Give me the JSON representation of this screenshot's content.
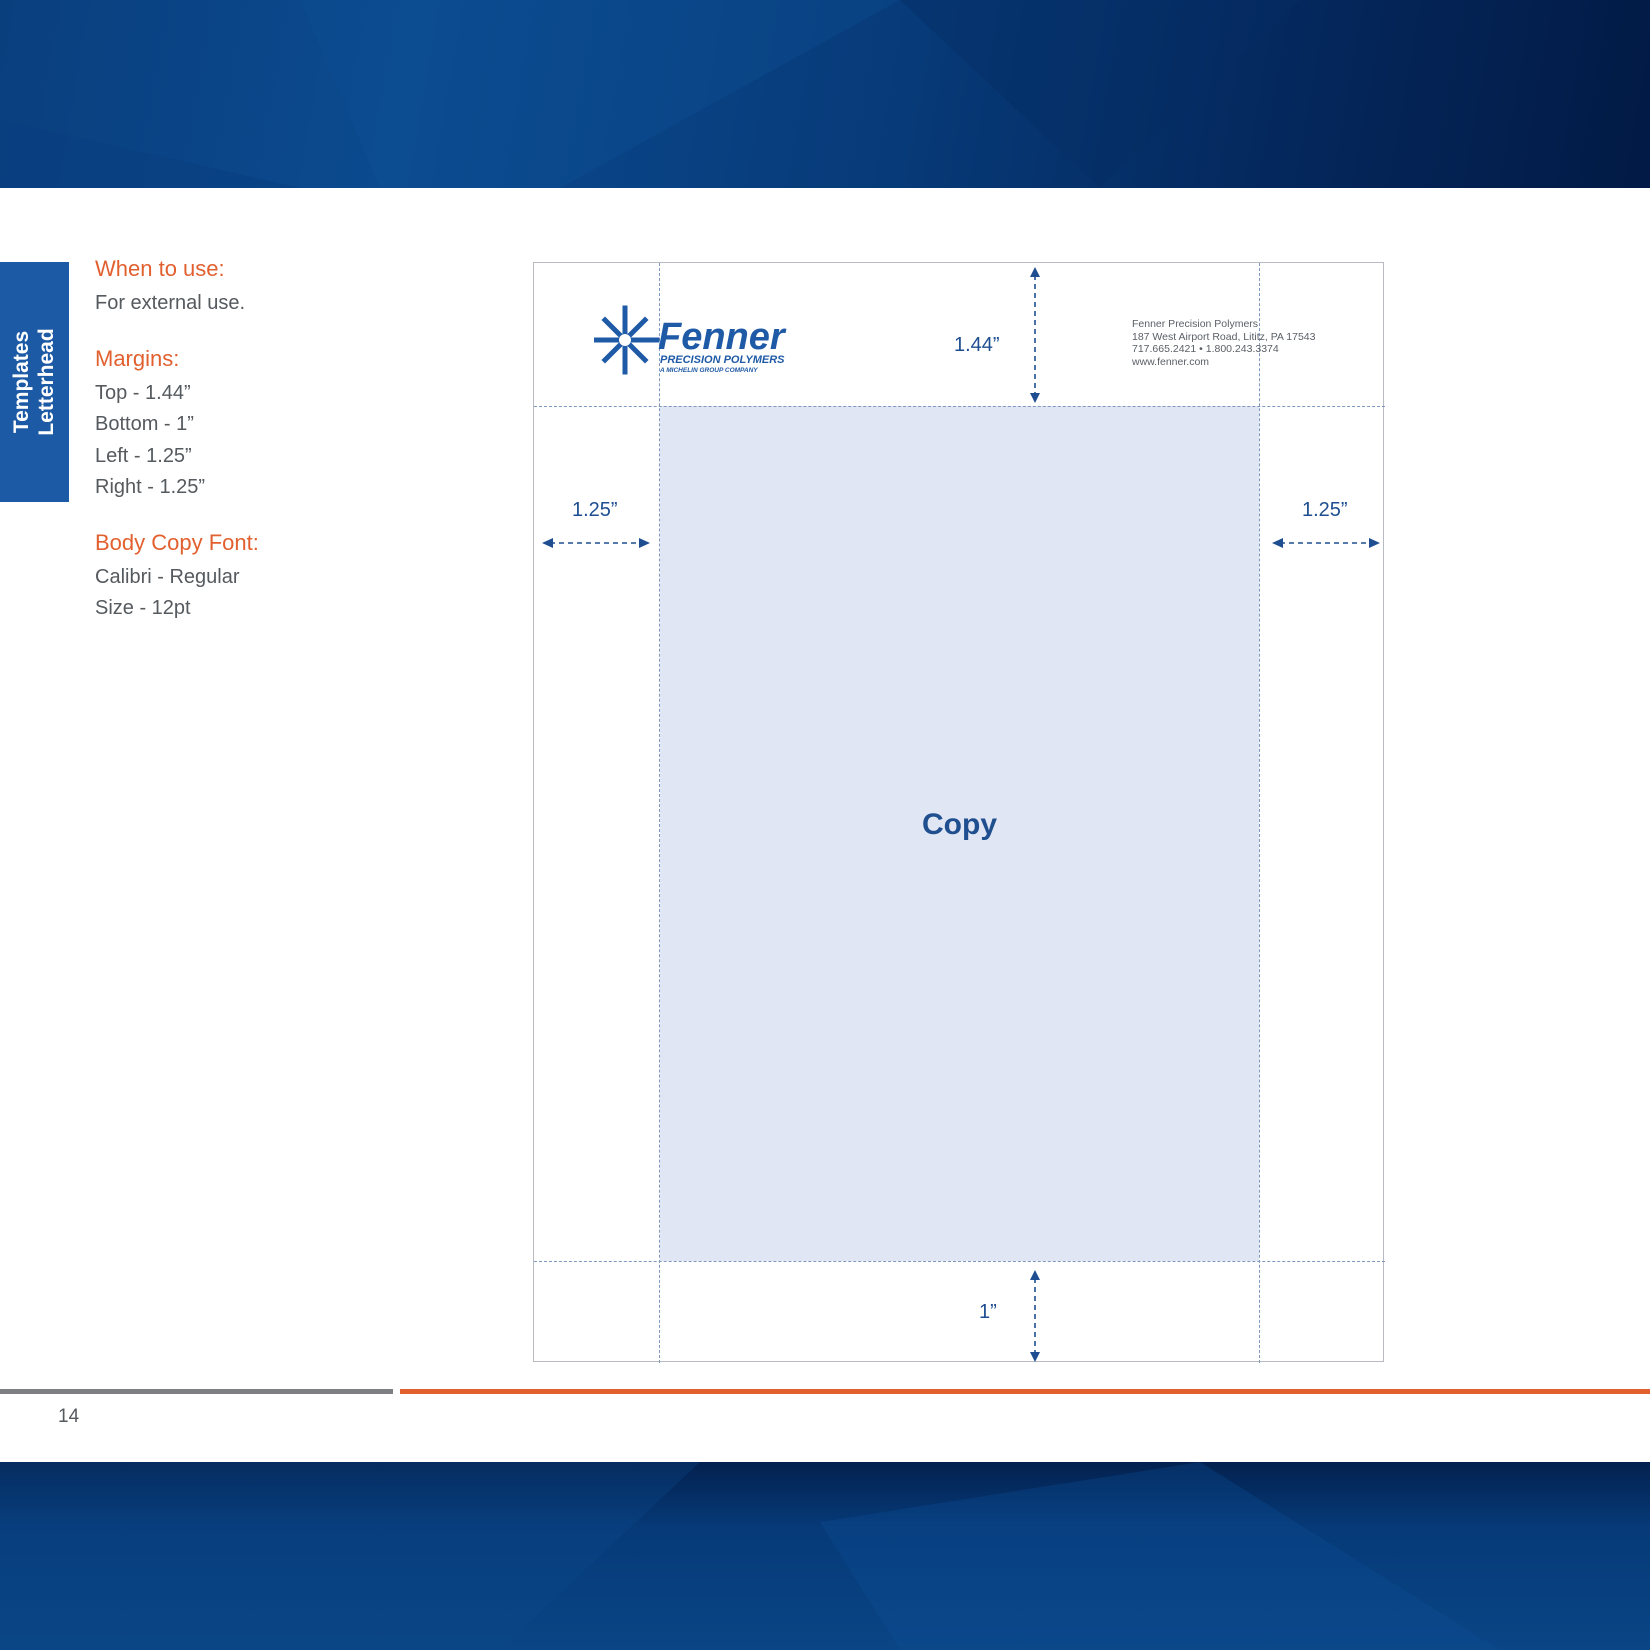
{
  "sidebar_tab": {
    "line1": "Templates",
    "line2": "Letterhead"
  },
  "sections": [
    {
      "heading": "When to use:",
      "lines": [
        "For external use."
      ]
    },
    {
      "heading": "Margins:",
      "lines": [
        "Top - 1.44”",
        "Bottom - 1”",
        "Left - 1.25”",
        "Right - 1.25”"
      ]
    },
    {
      "heading": "Body Copy Font:",
      "lines": [
        "Calibri - Regular",
        "Size - 12pt"
      ]
    }
  ],
  "letterhead": {
    "logo": {
      "name": "Fenner",
      "line1": "PRECISION POLYMERS",
      "line2": "A MICHELIN GROUP COMPANY"
    },
    "address": [
      "Fenner Precision Polymers",
      "187 West Airport Road, Lititz, PA 17543",
      "717.665.2421 • 1.800.243.3374",
      "www.fenner.com"
    ],
    "copy_label": "Copy",
    "dims": {
      "top": "1.44”",
      "left": "1.25”",
      "right": "1.25”",
      "bottom": "1”"
    }
  },
  "footer": {
    "page_number": "14"
  },
  "colors": {
    "brand_blue": "#1d5aa5",
    "accent_orange": "#e2602f",
    "rule_gray": "#7d7f82"
  }
}
